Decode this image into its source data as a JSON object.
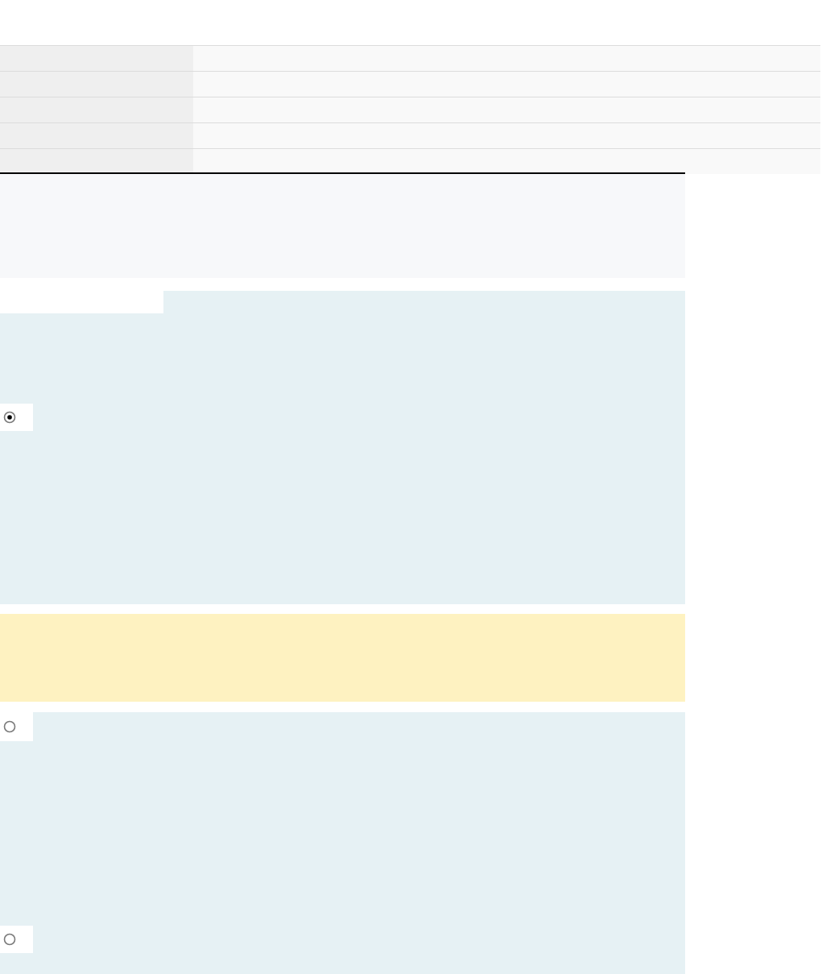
{
  "options": [
    {
      "selected": true
    },
    {
      "selected": false
    },
    {
      "selected": false
    }
  ]
}
